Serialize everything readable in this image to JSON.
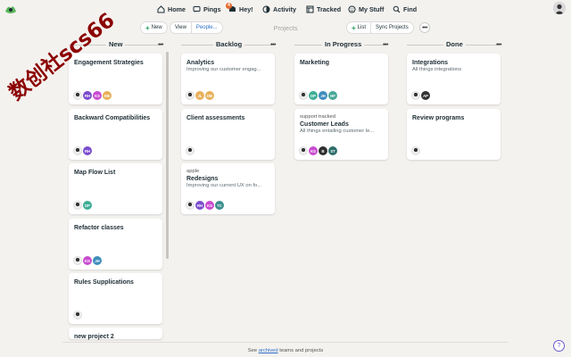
{
  "nav": {
    "home": "Home",
    "pings": "Pings",
    "hey": "Hey!",
    "hey_badge": "4",
    "activity": "Activity",
    "tracked": "Tracked",
    "my_stuff": "My Stuff",
    "find": "Find"
  },
  "toolbar": {
    "new_label": "New",
    "view_label": "View",
    "people_label": "People...",
    "heading": "Projects",
    "list_label": "List",
    "sync_label": "Sync Projects",
    "more": "•••"
  },
  "columns": [
    {
      "title": "New"
    },
    {
      "title": "Backlog"
    },
    {
      "title": "In Progress"
    },
    {
      "title": "Done"
    }
  ],
  "cards": {
    "new": [
      {
        "title": "Engagement Strategies",
        "avatars": [
          "photo",
          "RH",
          "KS",
          "DB"
        ]
      },
      {
        "title": "Backward Compatibilities",
        "avatars": [
          "photo",
          "RH"
        ]
      },
      {
        "title": "Map Flow List",
        "avatars": [
          "photo",
          "DP"
        ]
      },
      {
        "title": "Refactor classes",
        "avatars": [
          "photo",
          "KS",
          "JH"
        ]
      },
      {
        "title": "Rules Supplications",
        "avatars": [
          "photo"
        ]
      },
      {
        "title": "new project 2"
      }
    ],
    "backlog": [
      {
        "title": "Analytics",
        "desc": "Improving our customer engag...",
        "avatars": [
          "photo",
          "JL",
          "DB"
        ]
      },
      {
        "title": "Client assessments",
        "avatars": [
          "photo"
        ]
      },
      {
        "kicker": "apple",
        "title": "Redesigns",
        "desc": "Improving our current UX on fo...",
        "avatars": [
          "photo",
          "RH",
          "KS",
          "TC"
        ]
      }
    ],
    "in_progress": [
      {
        "title": "Marketing",
        "avatars": [
          "photo",
          "DP",
          "JH",
          "HF"
        ]
      },
      {
        "kicker": "support tracked",
        "title": "Customer Leads",
        "desc": "All things entailing customer le...",
        "avatars": [
          "photo",
          "KS",
          "B",
          "ST"
        ]
      }
    ],
    "done": [
      {
        "title": "Integrations",
        "desc": "All things integrations",
        "avatars": [
          "photo",
          "AP"
        ]
      },
      {
        "title": "Review programs",
        "avatars": [
          "photo"
        ]
      }
    ]
  },
  "avatar_colors": {
    "RH": "#7b4ccf",
    "KS": "#c94bd0",
    "DB": "#e8b05a",
    "DP": "#3cae96",
    "JH": "#3f8dbd",
    "HF": "#4ba79a",
    "JL": "#e8b05a",
    "TC": "#3a8e8c",
    "B": "#2f2f2f",
    "ST": "#2d6e6a",
    "AP": "#333333"
  },
  "footer": {
    "prefix": "See",
    "link": "archived",
    "suffix": "teams and projects"
  },
  "help": "?",
  "watermark": "数创社scs66"
}
